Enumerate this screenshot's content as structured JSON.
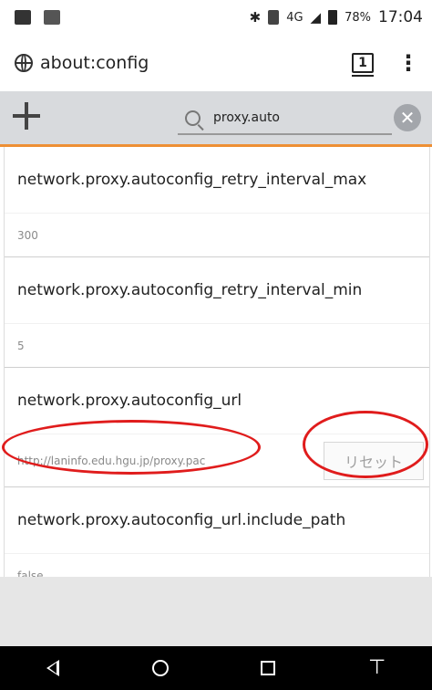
{
  "status_bar": {
    "battery": "78%",
    "time": "17:04",
    "network": "4G"
  },
  "url_bar": {
    "url": "about:config",
    "tab_count": "1",
    "menu": "⋮"
  },
  "toolbar": {
    "search_value": "proxy.auto",
    "clear_glyph": "✕"
  },
  "prefs": [
    {
      "name": "network.proxy.autoconfig_retry_interval_max",
      "value": "300"
    },
    {
      "name": "network.proxy.autoconfig_retry_interval_min",
      "value": "5"
    },
    {
      "name": "network.proxy.autoconfig_url",
      "value": "http://laninfo.edu.hgu.jp/proxy.pac",
      "reset_label": "リセット"
    },
    {
      "name": "network.proxy.autoconfig_url.include_path",
      "value": "false"
    }
  ],
  "colors": {
    "accent": "#ee8f34",
    "annotation": "#e01c1c",
    "toolbar_bg": "#d8dadd"
  },
  "icons": {
    "add": "plus-icon",
    "search": "search-icon",
    "clear": "clear-icon",
    "site": "globe-icon"
  }
}
